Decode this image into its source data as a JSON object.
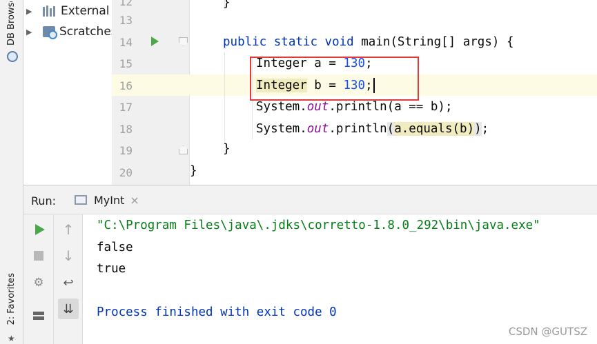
{
  "sidebar": {
    "db_browser_label": "DB Browser",
    "favorites_label": "2: Favorites"
  },
  "project_tree": {
    "items": [
      {
        "label": "External Libraries"
      },
      {
        "label": "Scratches and Consoles"
      }
    ]
  },
  "editor": {
    "line_numbers": [
      "12",
      "13",
      "14",
      "15",
      "16",
      "17",
      "18",
      "19",
      "20"
    ],
    "code": {
      "line12": "}",
      "line14": {
        "mod1": "public",
        "mod2": "static",
        "type": "void",
        "rest": " main(String[] args) {"
      },
      "line15": {
        "type": "Integer",
        "var": " a = ",
        "value": "130",
        "end": ";"
      },
      "line16": {
        "type": "Integer",
        "var": " b = ",
        "value": "130",
        "end": ";"
      },
      "line17": {
        "cls": "System.",
        "field": "out",
        "call": ".println(",
        "expr": "a == b",
        "end": ");"
      },
      "line18": {
        "cls": "System.",
        "field": "out",
        "call": ".println",
        "open": "(",
        "expr": "a.equals(b)",
        "close": ")",
        "end": ";"
      },
      "line19": "}",
      "line20": "}"
    }
  },
  "run_panel": {
    "label": "Run:",
    "tab_label": "MyInt",
    "tab_close": "×",
    "console": {
      "command": "\"C:\\Program Files\\java\\.jdks\\corretto-1.8.0_292\\bin\\java.exe\"",
      "output": [
        "false",
        "true"
      ],
      "process": "Process finished with exit code 0"
    }
  },
  "watermark": "CSDN @GUTSZ",
  "colors": {
    "keyword": "#0033b3",
    "number": "#1750eb",
    "static_field": "#871094",
    "console_command": "#067d17",
    "annotation": "#e03a3a",
    "run_green": "#4aa84a"
  },
  "icons": {
    "run_gutter": "play-icon",
    "run_tool": "play-icon",
    "stop_tool": "stop-icon",
    "rerun_tool": "rerun-icon",
    "layout_tool": "layout-icon",
    "up_tool": "arrow-up-icon",
    "down_tool": "arrow-down-icon",
    "wrap_tool": "soft-wrap-icon",
    "scroll_end_tool": "scroll-to-end-icon"
  }
}
